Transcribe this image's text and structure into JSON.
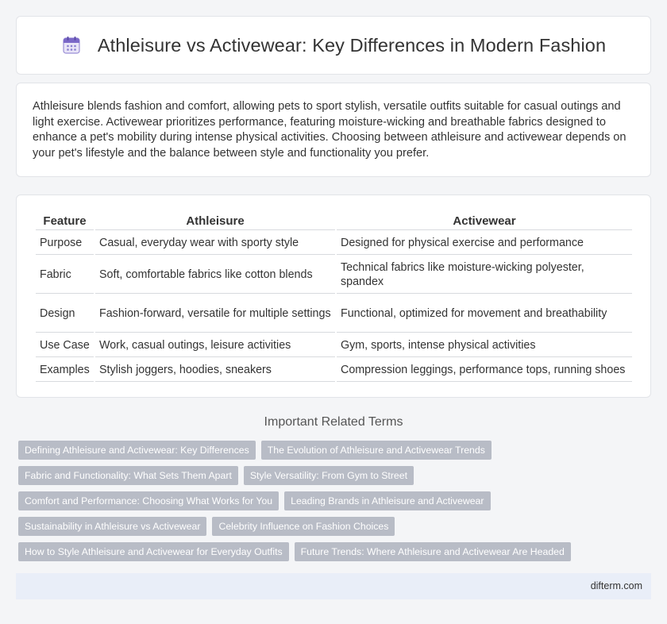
{
  "header": {
    "title": "Athleisure vs Activewear: Key Differences in Modern Fashion",
    "icon": "calendar-icon"
  },
  "intro": {
    "text": "Athleisure blends fashion and comfort, allowing pets to sport stylish, versatile outfits suitable for casual outings and light exercise. Activewear prioritizes performance, featuring moisture-wicking and breathable fabrics designed to enhance a pet's mobility during intense physical activities. Choosing between athleisure and activewear depends on your pet's lifestyle and the balance between style and functionality you prefer."
  },
  "table": {
    "headers": [
      "Feature",
      "Athleisure",
      "Activewear"
    ],
    "rows": [
      [
        "Purpose",
        "Casual, everyday wear with sporty style",
        "Designed for physical exercise and performance"
      ],
      [
        "Fabric",
        "Soft, comfortable fabrics like cotton blends",
        "Technical fabrics like moisture-wicking polyester, spandex"
      ],
      [
        "Design",
        "Fashion-forward, versatile for multiple settings",
        "Functional, optimized for movement and breathability"
      ],
      [
        "Use Case",
        "Work, casual outings, leisure activities",
        "Gym, sports, intense physical activities"
      ],
      [
        "Examples",
        "Stylish joggers, hoodies, sneakers",
        "Compression leggings, performance tops, running shoes"
      ]
    ]
  },
  "related": {
    "title": "Important Related Terms",
    "tags": [
      "Defining Athleisure and Activewear: Key Differences",
      "The Evolution of Athleisure and Activewear Trends",
      "Fabric and Functionality: What Sets Them Apart",
      "Style Versatility: From Gym to Street",
      "Comfort and Performance: Choosing What Works for You",
      "Leading Brands in Athleisure and Activewear",
      "Sustainability in Athleisure vs Activewear",
      "Celebrity Influence on Fashion Choices",
      "How to Style Athleisure and Activewear for Everyday Outfits",
      "Future Trends: Where Athleisure and Activewear Are Headed"
    ]
  },
  "footer": {
    "site": "difterm.com"
  },
  "colors": {
    "background": "#f4f5f7",
    "tag_bg": "#b8bcc6",
    "footer_bg": "#e9eef8",
    "icon_accent": "#7b68c8"
  }
}
